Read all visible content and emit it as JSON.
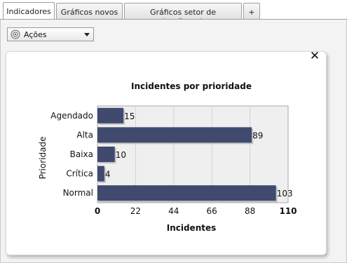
{
  "tabs": [
    {
      "label": "Indicadores",
      "active": true
    },
    {
      "label": "Gráficos novos",
      "active": false
    },
    {
      "label": "Gráficos setor de atendimento",
      "active": false
    },
    {
      "label": "+",
      "active": false
    }
  ],
  "toolbar": {
    "actions_label": "Ações",
    "actions_icon": "gear-icon"
  },
  "panel": {
    "close_label": "✕"
  },
  "chart_data": {
    "type": "bar",
    "orientation": "horizontal",
    "title": "Incidentes por prioridade",
    "xlabel": "Incidentes",
    "ylabel": "Prioridade",
    "categories": [
      "Agendado",
      "Alta",
      "Baixa",
      "Crítica",
      "Normal"
    ],
    "values": [
      15,
      89,
      10,
      4,
      103
    ],
    "xlim": [
      0,
      110
    ],
    "xticks": [
      "0",
      "22",
      "44",
      "66",
      "88",
      "110"
    ],
    "bar_color": "#3f4a6e",
    "grid": true
  }
}
